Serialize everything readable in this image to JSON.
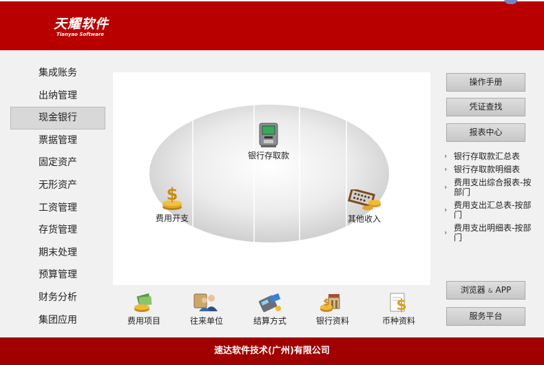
{
  "header": {
    "logo_cn": "天耀软件",
    "logo_en": "Tianyao Software"
  },
  "left_menu": {
    "items": [
      {
        "label": "集成账务"
      },
      {
        "label": "出纳管理"
      },
      {
        "label": "现金银行",
        "active": true
      },
      {
        "label": "票据管理"
      },
      {
        "label": "固定资产"
      },
      {
        "label": "无形资产"
      },
      {
        "label": "工资管理"
      },
      {
        "label": "存货管理"
      },
      {
        "label": "期末处理"
      },
      {
        "label": "预算管理"
      },
      {
        "label": "财务分析"
      },
      {
        "label": "集团应用"
      }
    ]
  },
  "flow": {
    "top": {
      "label": "银行存取款",
      "icon": "atm-icon"
    },
    "left": {
      "label": "费用开支",
      "icon": "dollar-stack-icon"
    },
    "right": {
      "label": "其他收入",
      "icon": "abacus-coins-icon"
    }
  },
  "bottom_items": [
    {
      "label": "费用项目",
      "icon": "expense-item-icon"
    },
    {
      "label": "往来单位",
      "icon": "contacts-icon"
    },
    {
      "label": "结算方式",
      "icon": "card-terminal-icon"
    },
    {
      "label": "银行资料",
      "icon": "bank-icon"
    },
    {
      "label": "币种资料",
      "icon": "currency-icon"
    }
  ],
  "right_panel": {
    "manual": "操作手册",
    "voucher_search": "凭证查找",
    "report_center": "报表中心",
    "reports": [
      "银行存取款汇总表",
      "银行存取款明细表",
      "费用支出综合报表-按部门",
      "费用支出汇总表-按部门",
      "费用支出明细表-按部门"
    ],
    "browser_main": "浏览器",
    "browser_amp": "&",
    "browser_app": "APP",
    "service": "服务平台"
  },
  "footer": {
    "company": "速达软件技术(广州)有限公司"
  },
  "colors": {
    "header_red": "#b80000",
    "footer_red": "#a00000",
    "menu_active_bg": "#d8d8d8",
    "panel_bg": "#ffffff",
    "page_bg": "#f1f1f1"
  }
}
